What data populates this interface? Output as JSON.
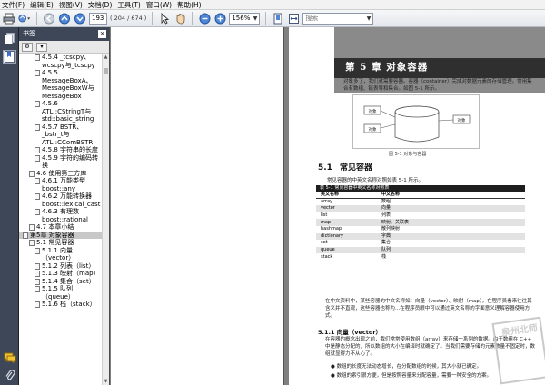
{
  "menubar": {
    "items": [
      "文件(F)",
      "编辑(E)",
      "视图(V)",
      "文档(D)",
      "工具(T)",
      "窗口(W)",
      "帮助(H)"
    ]
  },
  "toolbar": {
    "page_current": "193",
    "page_total": "( 204 / 674 )",
    "zoom": "156%",
    "search_placeholder": "搜索"
  },
  "bookmarks": {
    "title": "书签",
    "close_label": "×",
    "items": [
      {
        "text": "4.5.4 _tcscpy、wcscpy与_tcscpy",
        "level": 3
      },
      {
        "text": "4.5.5 MessageBoxA、MessageBoxW与MessageBox",
        "level": 3
      },
      {
        "text": "4.5.6 ATL::CStringT与std::basic_string",
        "level": 3
      },
      {
        "text": "4.5.7 BSTR、_bstr_t与ATL::CComBSTR",
        "level": 3
      },
      {
        "text": "4.5.8 字符串的长度",
        "level": 3
      },
      {
        "text": "4.5.9 字符的编码转换",
        "level": 3
      },
      {
        "text": "4.6 使用第三方库",
        "level": 2
      },
      {
        "text": "4.6.1 万能类型boost::any",
        "level": 3
      },
      {
        "text": "4.6.2 万能转换器boost::lexical_cast",
        "level": 3
      },
      {
        "text": "4.6.3 有理数boost::rational",
        "level": 3
      },
      {
        "text": "4.7 本章小结",
        "level": 2
      },
      {
        "text": "第5章 对象容器",
        "level": 1,
        "selected": true
      },
      {
        "text": "5.1 常见容器",
        "level": 2
      },
      {
        "text": "5.1.1 向量（vector）",
        "level": 3
      },
      {
        "text": "5.1.2 列表（list）",
        "level": 3
      },
      {
        "text": "5.1.3 映射（map）",
        "level": 3
      },
      {
        "text": "5.1.4 集合（set）",
        "level": 3
      },
      {
        "text": "5.1.5 队列（queue）",
        "level": 3
      },
      {
        "text": "5.1.6 栈（stack）",
        "level": 3
      }
    ]
  },
  "document": {
    "chapter_title": "第 5 章  对象容器",
    "chapter_intro": "对象多了，我们就需要容器。容器（container）完成对数据元素的存储管理。常用集合有数组、链表等和集合。如图 5-1 所示。",
    "figure": {
      "label_left_top": "对象",
      "label_left_bottom": "对象",
      "label_right": "对象",
      "caption": "图 5-1  对象与容器"
    },
    "section_number": "5.1",
    "section_title": "常见容器",
    "section_intro": "常见容器的中英文名称对照如表 5-1 所示。",
    "table": {
      "caption": "表 5-1  常见容器中英文名称对照表",
      "headers": [
        "英文名称",
        "中文名称"
      ],
      "rows": [
        [
          "array",
          "数组"
        ],
        [
          "vector",
          "向量"
        ],
        [
          "list",
          "列表"
        ],
        [
          "map",
          "映射、关联表"
        ],
        [
          "hashmap",
          "散列映射"
        ],
        [
          "dictionary",
          "字典"
        ],
        [
          "set",
          "集合"
        ],
        [
          "queue",
          "队列"
        ],
        [
          "stack",
          "栈"
        ]
      ]
    },
    "para1": "在中文资料中，某些容器的中文名称如：向量（vector）、映射（map），在程序员看来往往其含义并不直观，这些容器也称为...在程序员眼中可以通过英文名称的字面意义理解容器使用方式。",
    "subsection": "5.1.1  向量（vector）",
    "para2": "在容器的概念出现之前，我们常常使用数组（array）来存储一系列的数据。由于数组在 C++ 中是静态分配的，所以数组的大小在编译时就确定了。当我们需要存储的元素数量不固定时，数组就显得力不从心了。",
    "bullets": [
      "数组的长度无法动态增长，在分配数组的时候，其大小就已确定。",
      "数组的索引很方便，但是按照容量来分配容量，需要一种安全的方案。"
    ],
    "watermark": "泉州北师"
  }
}
